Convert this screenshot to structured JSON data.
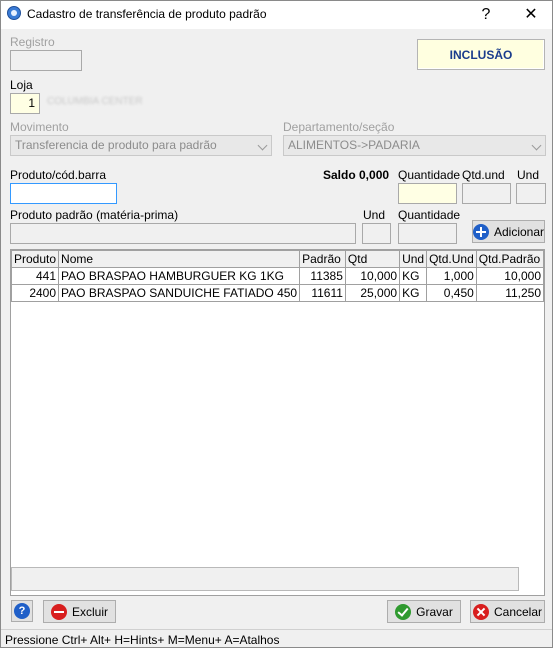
{
  "window": {
    "title": "Cadastro de transferência de produto padrão",
    "help_glyph": "?",
    "close_glyph": "✕"
  },
  "header": {
    "registro_label": "Registro",
    "registro_value": "",
    "mode_badge": "INCLUSÃO",
    "loja_label": "Loja",
    "loja_value": "1",
    "loja_name": "COLUMBIA CENTER"
  },
  "movimento": {
    "label": "Movimento",
    "value": "Transferencia de produto para padrão"
  },
  "departamento": {
    "label": "Departamento/seção",
    "value": "ALIMENTOS->PADARIA"
  },
  "product_entry": {
    "produto_label": "Produto/cód.barra",
    "produto_value": "",
    "saldo_label": "Saldo 0,000",
    "quantidade_label": "Quantidade",
    "qtd_und_label": "Qtd.und",
    "und_label": "Und",
    "padrao_label": "Produto padrão (matéria-prima)",
    "padrao_und_label": "Und",
    "padrao_quantidade_label": "Quantidade",
    "adicionar_label": "Adicionar"
  },
  "table": {
    "columns": [
      "Produto",
      "Nome",
      "Padrão",
      "Qtd",
      "Und",
      "Qtd.Und",
      "Qtd.Padrão"
    ],
    "rows": [
      [
        "441",
        "PAO BRASPAO HAMBURGUER KG 1KG",
        "11385",
        "10,000",
        "KG",
        "1,000",
        "10,000"
      ],
      [
        "2400",
        "PAO BRASPAO SANDUICHE FATIADO 450",
        "11611",
        "25,000",
        "KG",
        "0,450",
        "11,250"
      ]
    ]
  },
  "footer": {
    "excluir_label": "Excluir",
    "gravar_label": "Gravar",
    "cancelar_label": "Cancelar",
    "status_text": "Pressione Ctrl+ Alt+ H=Hints+ M=Menu+ A=Atalhos"
  },
  "colors": {
    "mode_badge_bg": "#ffffe0",
    "mode_badge_text": "#1a3c8c",
    "focus_border": "#3399ff"
  },
  "icons": {
    "app": "app-logo-icon",
    "help": "help-icon",
    "add": "plus-circle-icon",
    "delete": "minus-circle-icon",
    "save": "checkmark-icon",
    "cancel": "x-circle-icon"
  }
}
